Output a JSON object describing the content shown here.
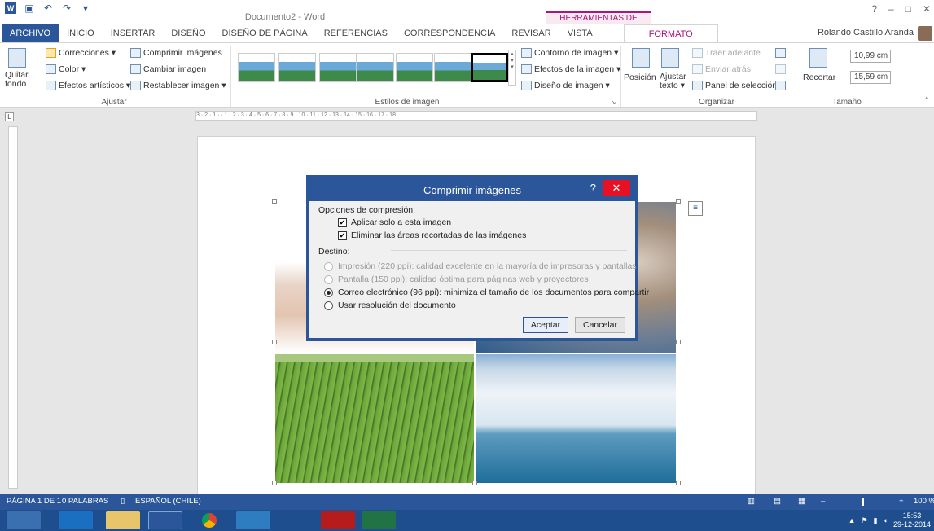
{
  "title_bar": {
    "doc_title": "Documento2 - Word",
    "contextual_label": "HERRAMIENTAS DE IMAGEN",
    "window_controls": [
      "?",
      "–",
      "□",
      "✕"
    ]
  },
  "tabs": [
    "ARCHIVO",
    "INICIO",
    "INSERTAR",
    "DISEÑO",
    "DISEÑO DE PÁGINA",
    "REFERENCIAS",
    "CORRESPONDENCIA",
    "REVISAR",
    "VISTA"
  ],
  "active_tab": "FORMATO",
  "user": "Rolando Castillo Aranda",
  "ribbon": {
    "ajustar": {
      "quitar_fondo": "Quitar fondo",
      "correcciones": "Correcciones ▾",
      "color": "Color ▾",
      "efectos": "Efectos artísticos ▾",
      "comprimir": "Comprimir imágenes",
      "cambiar": "Cambiar imagen",
      "restablecer": "Restablecer imagen ▾",
      "label": "Ajustar"
    },
    "estilos": {
      "contorno": "Contorno de imagen ▾",
      "efectos": "Efectos de la imagen ▾",
      "diseno": "Diseño de imagen ▾",
      "label": "Estilos de imagen"
    },
    "organizar": {
      "posicion": "Posición",
      "ajustar_texto": "Ajustar texto ▾",
      "traer": "Traer adelante",
      "enviar": "Enviar atrás",
      "panel": "Panel de selección",
      "label": "Organizar"
    },
    "tamano": {
      "recortar": "Recortar",
      "alto": "10,99 cm",
      "ancho": "15,59 cm",
      "label": "Tamaño"
    }
  },
  "ruler_text": "3 · 2 · 1 · · 1 · 2 · 3 · 4 · 5 · 6 · 7 · 8 · 9 · 10 · 11 · 12 · 13 · 14 · 15 · 16 · 17 · 18",
  "dialog": {
    "title": "Comprimir imágenes",
    "help": "?",
    "options_heading": "Opciones de compresión:",
    "apply_only": "Aplicar solo a esta imagen",
    "delete_cropped": "Eliminar las áreas recortadas de las imágenes",
    "target_heading": "Destino:",
    "targets": [
      {
        "label": "Impresión (220 ppi): calidad excelente en la mayoría de impresoras y pantallas",
        "enabled": false,
        "selected": false
      },
      {
        "label": "Pantalla (150 ppi): calidad óptima para páginas web y proyectores",
        "enabled": false,
        "selected": false
      },
      {
        "label": "Correo electrónico (96 ppi): minimiza el tamaño de los documentos para compartir",
        "enabled": true,
        "selected": true
      },
      {
        "label": "Usar resolución del documento",
        "enabled": true,
        "selected": false
      }
    ],
    "ok": "Aceptar",
    "cancel": "Cancelar"
  },
  "status_bar": {
    "page": "PÁGINA 1 DE 1",
    "words": "0 PALABRAS",
    "language": "ESPAÑOL (CHILE)",
    "zoom": "100 %"
  },
  "taskbar": {
    "time": "15:53",
    "date": "29-12-2014"
  }
}
